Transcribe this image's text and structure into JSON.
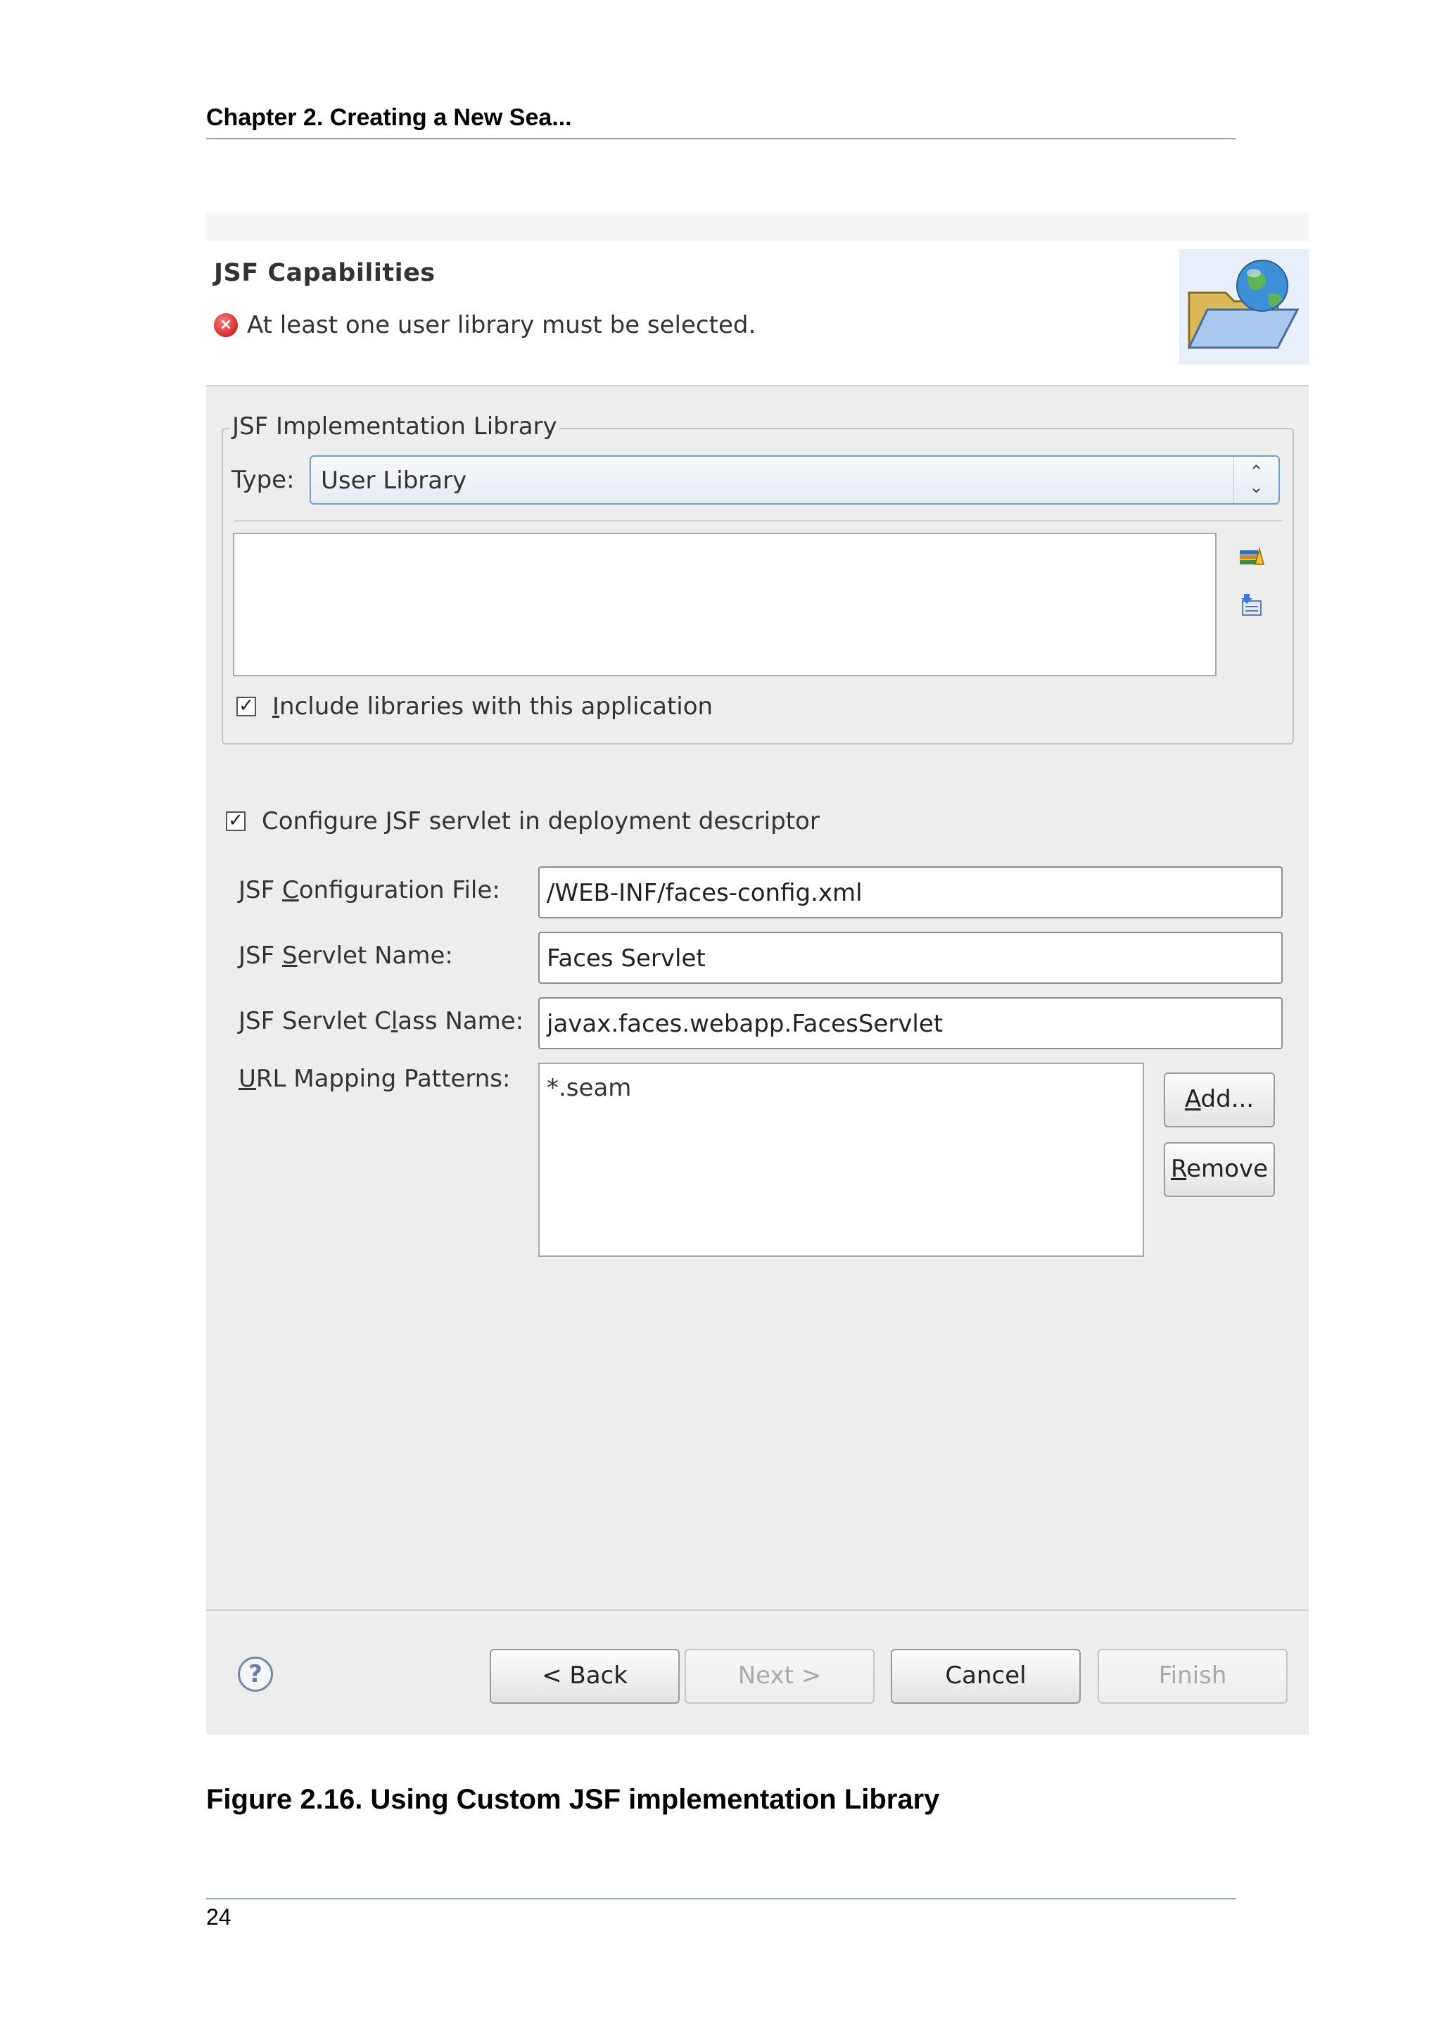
{
  "document": {
    "header": "Chapter 2. Creating a New Sea...",
    "caption": "Figure 2.16. Using Custom JSF implementation Library",
    "page_number": "24"
  },
  "dialog": {
    "banner": {
      "title": "JSF Capabilities",
      "error_message": "At least one user library must be selected.",
      "icons": [
        "error-icon",
        "folder-globe-icon"
      ]
    },
    "implementation_group": {
      "legend": "JSF Implementation Library",
      "type_label": "Type:",
      "type_value": "User Library",
      "libraries": [],
      "side_icons": [
        "manage-libraries-icon",
        "download-library-icon"
      ],
      "include_checkbox": {
        "checked": true,
        "label_mnemonic": "I",
        "label_rest": "nclude libraries with this application"
      }
    },
    "configure_checkbox": {
      "checked": true,
      "label_pre": "Configure ",
      "label_mnemonic": "J",
      "label_post": "SF servlet in deployment descriptor"
    },
    "fields": {
      "config_file": {
        "label_pre": "JSF ",
        "label_mnemonic": "C",
        "label_post": "onfiguration File:",
        "value": "/WEB-INF/faces-config.xml"
      },
      "servlet_name": {
        "label_pre": "JSF ",
        "label_mnemonic": "S",
        "label_post": "ervlet Name:",
        "value": "Faces Servlet"
      },
      "servlet_class": {
        "label_pre": "JSF Servlet C",
        "label_mnemonic": "l",
        "label_post": "ass Name:",
        "value": "javax.faces.webapp.FacesServlet"
      },
      "url_patterns": {
        "label_mnemonic": "U",
        "label_rest": "RL Mapping Patterns:",
        "items": [
          "*.seam"
        ]
      }
    },
    "url_buttons": {
      "add": {
        "mnemonic": "A",
        "rest": "dd..."
      },
      "remove": {
        "mnemonic": "R",
        "rest": "emove"
      }
    },
    "footer_buttons": {
      "back": {
        "label": "< Back",
        "enabled": true
      },
      "next": {
        "label": "Next >",
        "enabled": false
      },
      "cancel": {
        "label": "Cancel",
        "enabled": true
      },
      "finish": {
        "label": "Finish",
        "enabled": false
      }
    },
    "help_icon": "?"
  }
}
